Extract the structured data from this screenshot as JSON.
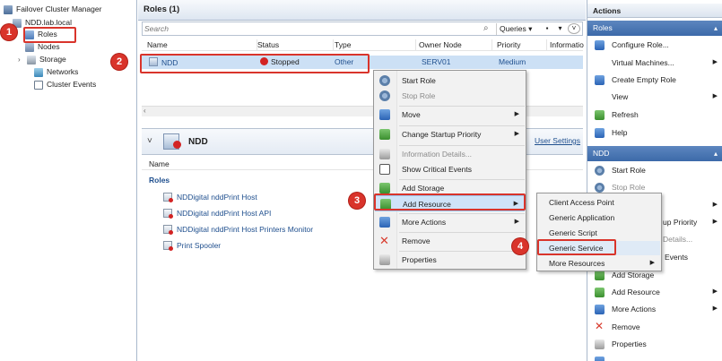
{
  "tree": {
    "items": [
      {
        "label": "Failover Cluster Manager",
        "icon": "cluster-icon"
      },
      {
        "label": "NDD.lab.local",
        "icon": "cluster-node-icon"
      },
      {
        "label": "Roles",
        "icon": "roles-icon"
      },
      {
        "label": "Nodes",
        "icon": "nodes-icon"
      },
      {
        "label": "Storage",
        "icon": "storage-icon"
      },
      {
        "label": "Networks",
        "icon": "networks-icon"
      },
      {
        "label": "Cluster Events",
        "icon": "cluster-events-icon"
      }
    ]
  },
  "roles_pane": {
    "title": "Roles (1)",
    "search_placeholder": "Search",
    "queries_label": "Queries",
    "columns": [
      "Name",
      "Status",
      "Type",
      "Owner Node",
      "Priority",
      "Informatio"
    ],
    "rows": [
      {
        "name": "NDD",
        "status": "Stopped",
        "type": "Other",
        "owner_node": "SERV01",
        "priority": "Medium"
      }
    ]
  },
  "detail": {
    "title": "NDD",
    "user_settings": "User Settings",
    "column_name": "Name",
    "group": "Roles",
    "resources": [
      "NDDigital nddPrint Host",
      "NDDigital nddPrint Host API",
      "NDDigital nddPrint Host Printers Monitor",
      "Print Spooler"
    ]
  },
  "context_menu": {
    "items": [
      {
        "label": "Start Role",
        "icon": "start-role-icon"
      },
      {
        "label": "Stop Role",
        "icon": "stop-role-icon",
        "disabled": true
      },
      {
        "label": "Move",
        "icon": "move-icon",
        "submenu": true
      },
      {
        "label": "Change Startup Priority",
        "icon": "startup-priority-icon",
        "submenu": true
      },
      {
        "label": "Information Details...",
        "icon": "information-details-icon",
        "disabled": true
      },
      {
        "label": "Show Critical Events",
        "icon": "critical-events-icon"
      },
      {
        "label": "Add Storage",
        "icon": "add-storage-icon"
      },
      {
        "label": "Add Resource",
        "icon": "add-resource-icon",
        "submenu": true
      },
      {
        "label": "More Actions",
        "icon": "more-actions-icon",
        "submenu": true
      },
      {
        "label": "Remove",
        "icon": "remove-icon"
      },
      {
        "label": "Properties",
        "icon": "properties-icon"
      }
    ]
  },
  "sub_menu": {
    "items": [
      {
        "label": "Client Access Point"
      },
      {
        "label": "Generic Application"
      },
      {
        "label": "Generic Script"
      },
      {
        "label": "Generic Service"
      },
      {
        "label": "More Resources",
        "submenu": true
      }
    ]
  },
  "actions": {
    "header": "Actions",
    "roles_section": "Roles",
    "roles_items": [
      {
        "label": "Configure Role...",
        "icon": "configure-role-icon"
      },
      {
        "label": "Virtual Machines...",
        "icon": "",
        "submenu": true
      },
      {
        "label": "Create Empty Role",
        "icon": "create-empty-role-icon"
      },
      {
        "label": "View",
        "icon": "",
        "submenu": true
      },
      {
        "label": "Refresh",
        "icon": "refresh-icon"
      },
      {
        "label": "Help",
        "icon": "help-icon"
      }
    ],
    "ndd_section": "NDD",
    "ndd_items": [
      {
        "label": "Start Role",
        "icon": "start-role-icon"
      },
      {
        "label": "Stop Role",
        "icon": "stop-role-icon",
        "disabled": true
      },
      {
        "label": "",
        "icon": "",
        "submenu": true
      },
      {
        "label": "up Priority",
        "icon": "",
        "submenu": true
      },
      {
        "label": "Details...",
        "icon": "",
        "disabled": true
      },
      {
        "label": "Events",
        "icon": ""
      },
      {
        "label": "Add Storage",
        "icon": "add-storage-icon"
      },
      {
        "label": "Add Resource",
        "icon": "add-resource-icon",
        "submenu": true
      },
      {
        "label": "More Actions",
        "icon": "more-actions-icon",
        "submenu": true
      },
      {
        "label": "Remove",
        "icon": "remove-icon"
      },
      {
        "label": "Properties",
        "icon": "properties-icon"
      }
    ]
  },
  "annotations": [
    "1",
    "2",
    "3",
    "4"
  ],
  "colors": {
    "highlight": "#d9342b",
    "selection": "#cce0f5",
    "link": "#1f4f8e"
  }
}
